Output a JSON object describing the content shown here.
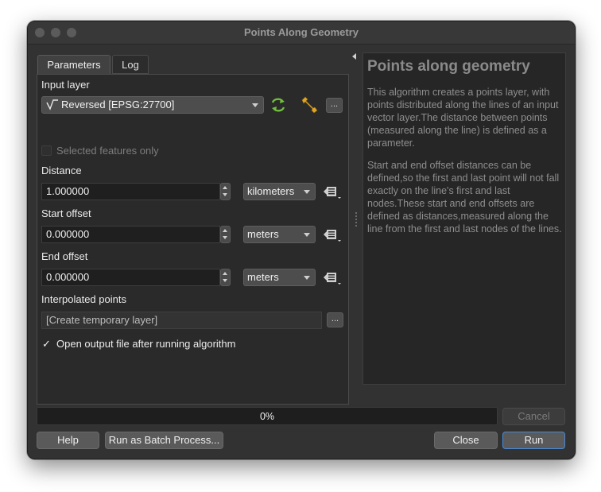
{
  "window": {
    "title": "Points Along Geometry"
  },
  "tabs": [
    {
      "label": "Parameters"
    },
    {
      "label": "Log"
    }
  ],
  "form": {
    "input_layer": {
      "label": "Input layer",
      "value": "Reversed [EPSG:27700]",
      "more": "..."
    },
    "selected_only": {
      "label": "Selected features only",
      "checked": false
    },
    "distance": {
      "label": "Distance",
      "value": "1.000000",
      "unit": "kilometers"
    },
    "start_offset": {
      "label": "Start offset",
      "value": "0.000000",
      "unit": "meters"
    },
    "end_offset": {
      "label": "End offset",
      "value": "0.000000",
      "unit": "meters"
    },
    "output": {
      "label": "Interpolated points",
      "value": "[Create temporary layer]",
      "more": "..."
    },
    "open_output": {
      "label": "Open output file after running algorithm",
      "checked": true,
      "check_glyph": "✓"
    }
  },
  "help": {
    "title": "Points along geometry",
    "paragraph1": "This algorithm creates a points layer, with points distributed along the lines of an input vector layer.The distance between points (measured along the line) is defined as a parameter.",
    "paragraph2": "Start and end offset distances can be defined,so the first and last point will not fall exactly on the line's first and last nodes.These start and end offsets are defined as distances,measured along the line from the first and last nodes of the lines."
  },
  "progress": {
    "value": 0,
    "label": "0%"
  },
  "buttons": {
    "cancel": "Cancel",
    "help": "Help",
    "batch": "Run as Batch Process...",
    "close": "Close",
    "run": "Run"
  },
  "colors": {
    "accent": "#3b7bd4",
    "refresh_icon": "#6fbf3f",
    "wrench_icon": "#e0a62a"
  }
}
